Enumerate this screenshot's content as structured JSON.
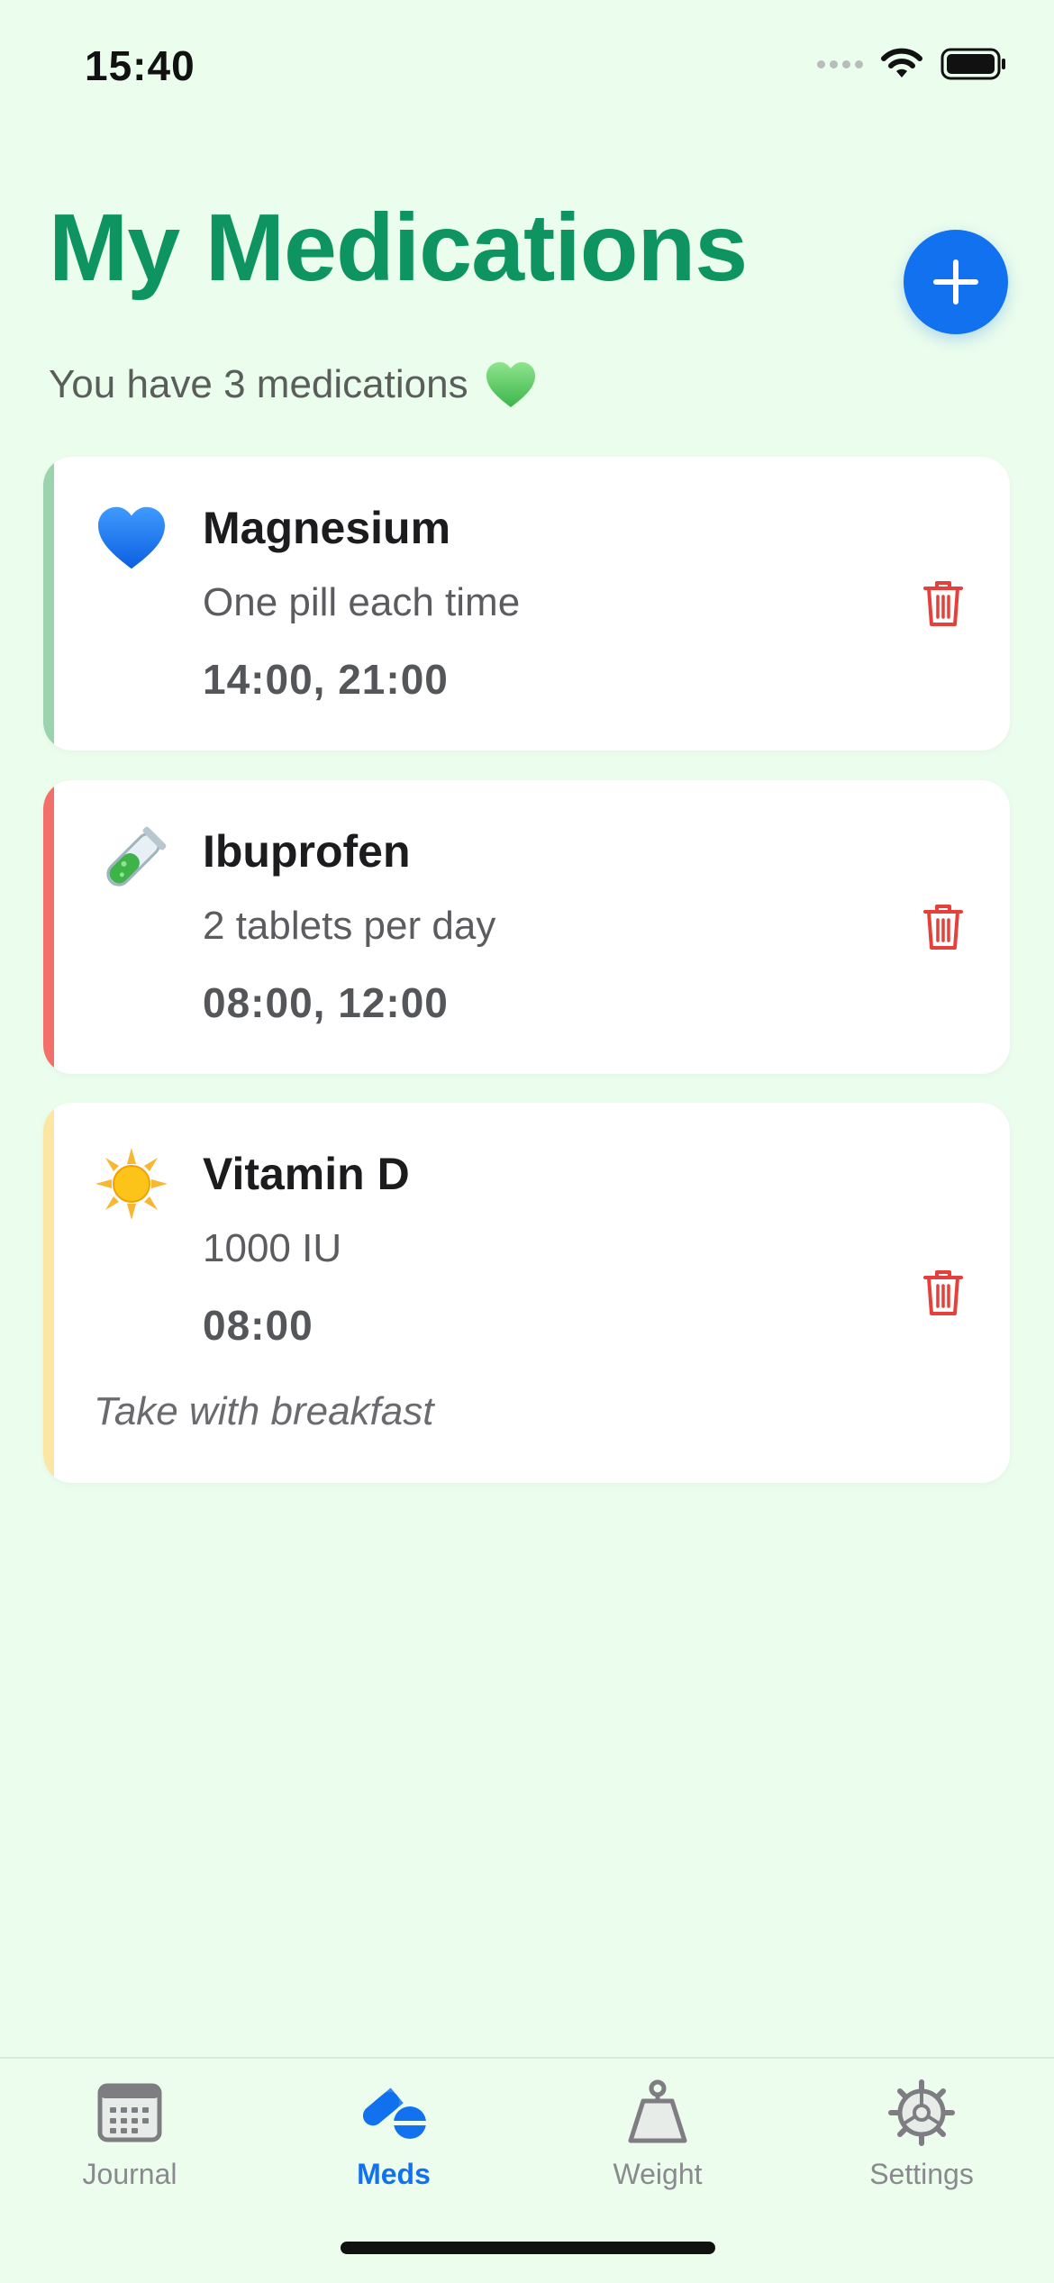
{
  "status_bar": {
    "time": "15:40",
    "icons": [
      "signal-dots-icon",
      "wifi-icon",
      "battery-icon"
    ]
  },
  "header": {
    "title": "My Medications",
    "subtitle": "You have 3 medications",
    "subtitle_emoji": "green-heart-icon",
    "add_icon": "plus-icon"
  },
  "medications": [
    {
      "icon": "blue-heart-icon",
      "accent_color": "#9bd3ae",
      "name": "Magnesium",
      "description": "One pill each time",
      "times": "14:00, 21:00",
      "note": ""
    },
    {
      "icon": "test-tube-icon",
      "accent_color": "#f36f6a",
      "name": "Ibuprofen",
      "description": "2 tablets per day",
      "times": "08:00, 12:00",
      "note": ""
    },
    {
      "icon": "sun-icon",
      "accent_color": "#fbe6a3",
      "name": "Vitamin D",
      "description": "1000 IU",
      "times": "08:00",
      "note": "Take with breakfast"
    }
  ],
  "colors": {
    "background": "#ebfdec",
    "title": "#0d9460",
    "accent_blue": "#1171ef",
    "delete_red": "#e5403a"
  },
  "tab_bar": {
    "tabs": [
      {
        "label": "Journal",
        "icon": "calendar-icon",
        "active": false
      },
      {
        "label": "Meds",
        "icon": "pills-icon",
        "active": true
      },
      {
        "label": "Weight",
        "icon": "scale-weight-icon",
        "active": false
      },
      {
        "label": "Settings",
        "icon": "gear-icon",
        "active": false
      }
    ]
  }
}
